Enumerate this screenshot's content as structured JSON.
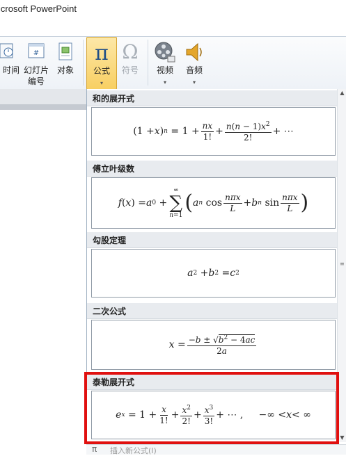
{
  "window": {
    "title": "icrosoft PowerPoint"
  },
  "ribbon": {
    "datetime_label": "日期和时间",
    "slide_number_label": "幻灯片\n编号",
    "slide_number_line1": "幻灯片",
    "slide_number_line2": "编号",
    "object_label": "对象",
    "equation_label": "公式",
    "symbol_label": "符号",
    "video_label": "视频",
    "audio_label": "音频",
    "dropdown_glyph": "▾"
  },
  "gallery": {
    "sections": [
      {
        "title": "和的展开式"
      },
      {
        "title": "傅立叶级数"
      },
      {
        "title": "勾股定理"
      },
      {
        "title": "二次公式"
      },
      {
        "title": "泰勒展开式"
      }
    ],
    "footer_label": "插入新公式(I)"
  },
  "colors": {
    "highlight": "#e0100f",
    "accent": "#f8cf62"
  },
  "icons": [
    "slide-number-icon",
    "object-icon",
    "pi-icon",
    "omega-icon",
    "video-reel-icon",
    "speaker-icon"
  ]
}
